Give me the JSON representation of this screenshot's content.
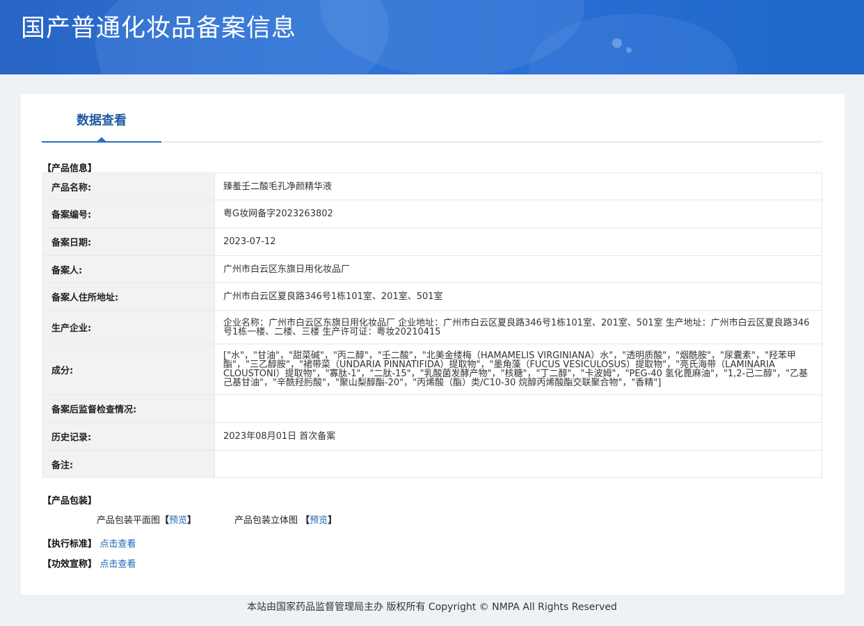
{
  "banner": {
    "title": "国产普通化妆品备案信息"
  },
  "tabs": [
    {
      "label": "数据查看"
    }
  ],
  "sections": {
    "product_info": "【产品信息】",
    "packaging": "【产品包装】",
    "standard_label": "【执行标准】",
    "efficacy_label": "【功效宣称】"
  },
  "product_info_rows": [
    {
      "key": "产品名称:",
      "value": "臻羞壬二酸毛孔净颜精华液"
    },
    {
      "key": "备案编号:",
      "value": "粤G妆网备字2023263802"
    },
    {
      "key": "备案日期:",
      "value": "2023-07-12"
    },
    {
      "key": "备案人:",
      "value": "广州市白云区东旗日用化妆品厂"
    },
    {
      "key": "备案人住所地址:",
      "value": "广州市白云区夏良路346号1栋101室、201室、501室"
    },
    {
      "key": "生产企业:",
      "value": "企业名称：广州市白云区东旗日用化妆品厂 企业地址：广州市白云区夏良路346号1栋101室、201室、501室 生产地址：广州市白云区夏良路346号1栋一楼、二楼、三楼 生产许可证：粤妆20210415"
    },
    {
      "key": "成分:",
      "value": "[\"水\"，\"甘油\"，\"甜菜碱\"，\"丙二醇\"，\"壬二酸\"，\"北美金缕梅（HAMAMELIS VIRGINIANA）水\"，\"透明质酸\"，\"烟酰胺\"，\"尿囊素\"，\"羟苯甲酯\"，\"三乙醇胺\"，\"裙带菜（UNDARIA PINNATIFIDA）提取物\"，\"墨角藻（FUCUS VESICULOSUS）提取物\"，\"亮氏海带（LAMINARIA CLOUSTONI）提取物\"，\"寡肽-1\"，\"二肽-15\"，\"乳酸菌发酵产物\"，\"核糖\"，\"丁二醇\"，\"卡波姆\"，\"PEG-40 氢化蓖麻油\"，\"1,2-己二醇\"，\"乙基己基甘油\"，\"辛酰羟肟酸\"，\"聚山梨醇酯-20\"，\"丙烯酸（酯）类/C10-30 烷醇丙烯酸酯交联聚合物\"，\"香精\"]"
    },
    {
      "key": "备案后监督检查情况:",
      "value": ""
    },
    {
      "key": "历史记录:",
      "value": "2023年08月01日 首次备案"
    },
    {
      "key": "备注:",
      "value": ""
    }
  ],
  "packaging": {
    "flat_label": "产品包装平面图",
    "solid_label": "产品包装立体图",
    "preview_open": "【",
    "preview_text": "预览",
    "preview_close": "】"
  },
  "links": {
    "view_text": "点击查看"
  },
  "footer": {
    "text": "本站由国家药品监督管理局主办 版权所有 Copyright © NMPA All Rights Reserved"
  }
}
